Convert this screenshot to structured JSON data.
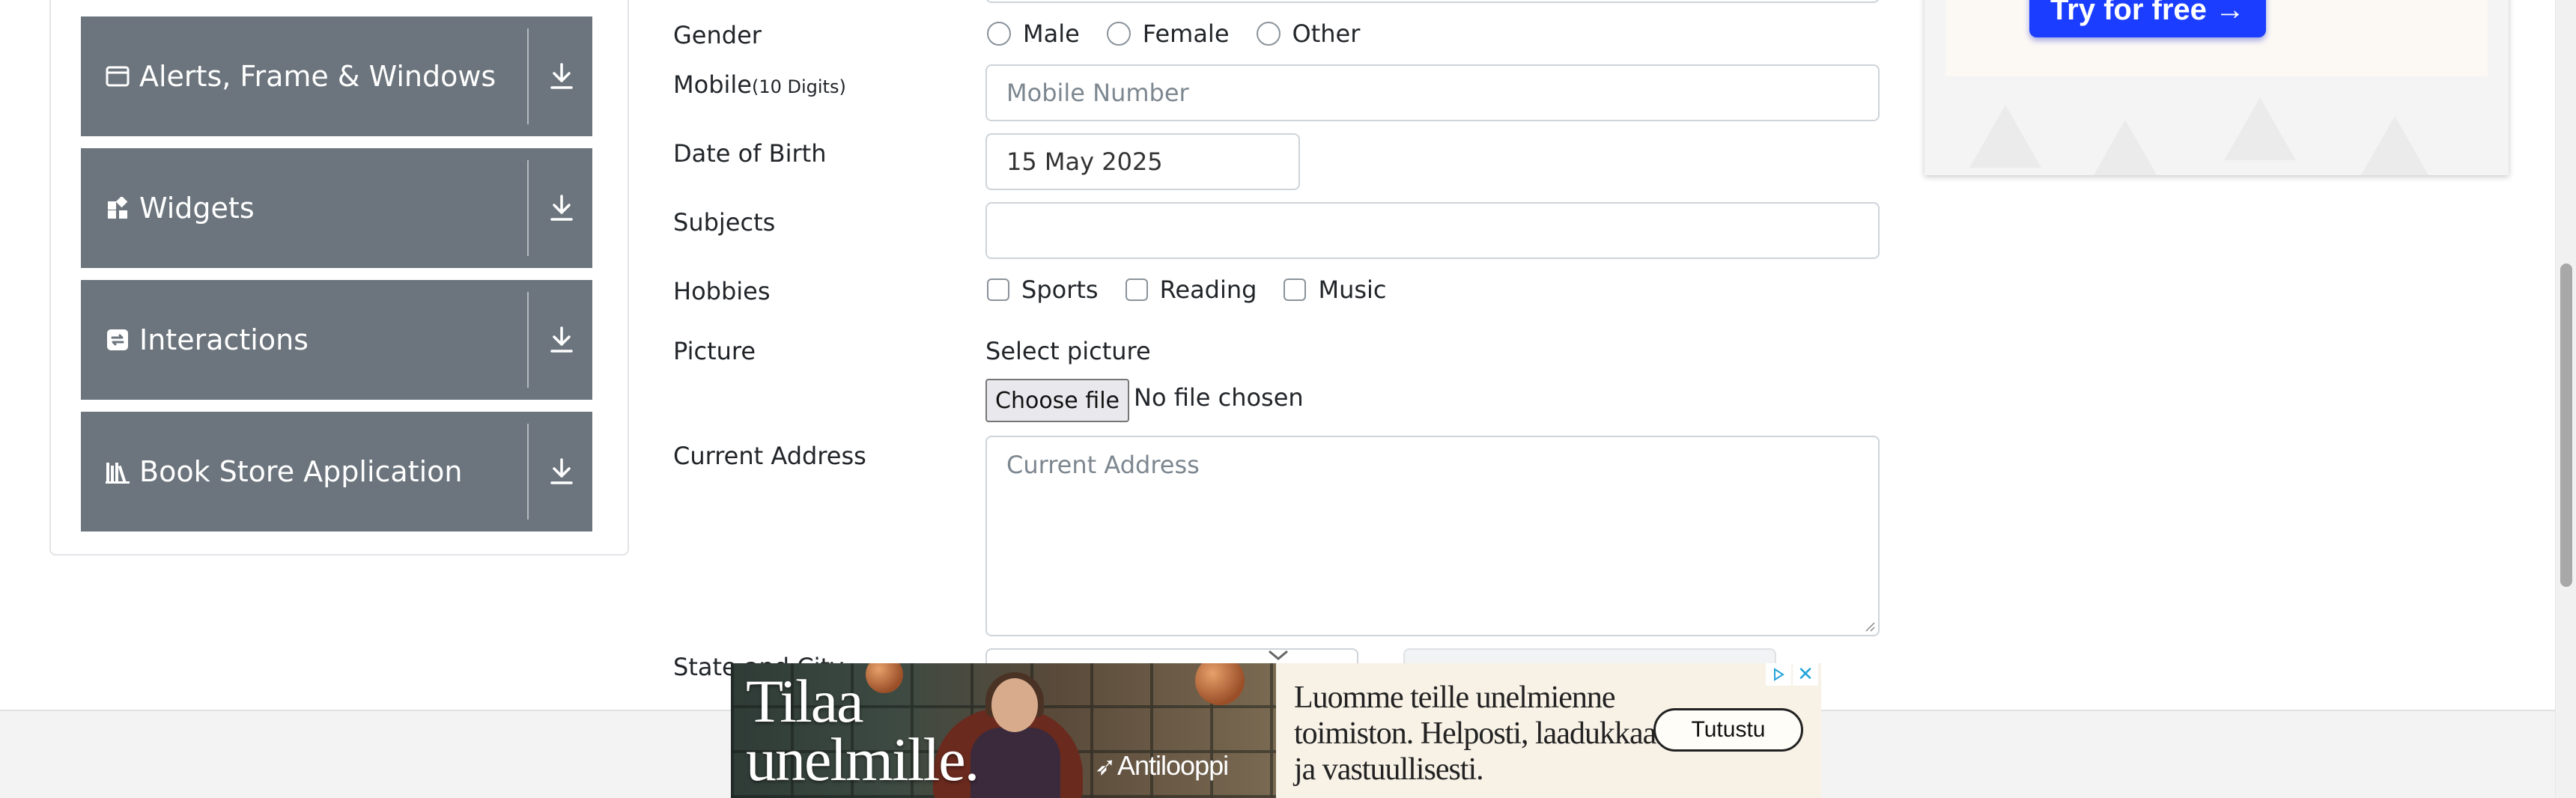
{
  "sidebar": {
    "groups": [
      {
        "label": "Alerts, Frame & Windows",
        "icon": "window-icon"
      },
      {
        "label": "Widgets",
        "icon": "widgets-icon"
      },
      {
        "label": "Interactions",
        "icon": "interactions-icon"
      },
      {
        "label": "Book Store Application",
        "icon": "books-icon"
      }
    ]
  },
  "form": {
    "gender": {
      "label": "Gender",
      "options": [
        "Male",
        "Female",
        "Other"
      ]
    },
    "mobile": {
      "label": "Mobile",
      "hint": "(10 Digits)",
      "placeholder": "Mobile Number"
    },
    "dob": {
      "label": "Date of Birth",
      "value": "15 May 2025"
    },
    "subjects": {
      "label": "Subjects",
      "value": ""
    },
    "hobbies": {
      "label": "Hobbies",
      "options": [
        "Sports",
        "Reading",
        "Music"
      ]
    },
    "picture": {
      "label": "Picture",
      "select_text": "Select picture",
      "button_label": "Choose file",
      "file_status": "No file chosen"
    },
    "address": {
      "label": "Current Address",
      "placeholder": "Current Address"
    },
    "state_city": {
      "label": "State and City"
    }
  },
  "side_ad": {
    "button_label": "Try for free →"
  },
  "bottom_ad": {
    "headline_line1": "Tilaa",
    "headline_line2": "unelmille.",
    "brand": "Antilooppi",
    "copy_line1": "Luomme teille unelmienne",
    "copy_line2": "toimiston. Helposti, laadukkaasti",
    "copy_line3": "ja vastuullisesti.",
    "cta_label": "Tutustu"
  },
  "colors": {
    "group_header_bg": "#6c757d",
    "input_border": "#ced4da",
    "placeholder_text": "#7d8790",
    "side_ad_button": "#1a3dff"
  }
}
